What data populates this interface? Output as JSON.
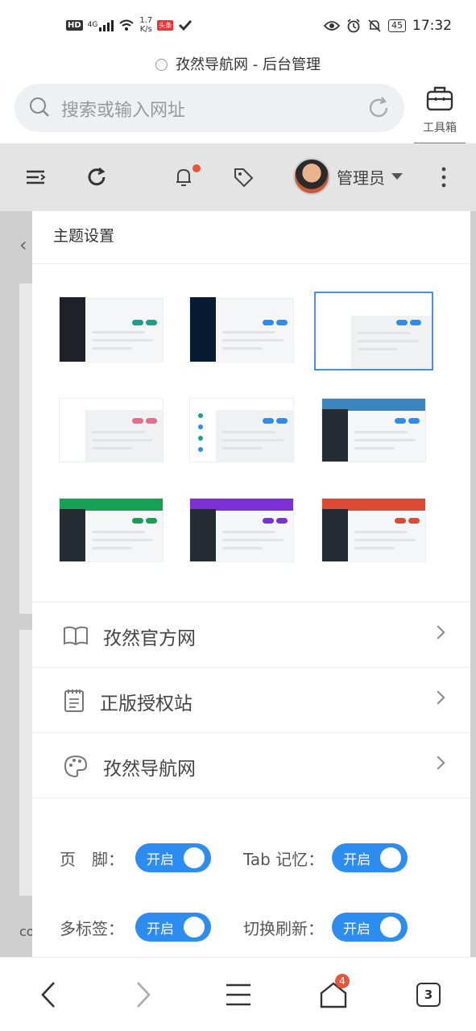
{
  "status_bar": {
    "left_badge": "HD",
    "network": "4G",
    "speed_value": "1.7",
    "speed_unit": "K/s",
    "news_badge": "头条",
    "battery": "45",
    "time": "17:32"
  },
  "browser": {
    "page_title": "孜然导航网 - 后台管理",
    "search_placeholder": "搜索或输入网址",
    "toolbox_label": "工具箱"
  },
  "admin_header": {
    "user_name": "管理员"
  },
  "background_page": {
    "fragment": "co"
  },
  "theme_drawer": {
    "title": "主题设置",
    "themes": [
      {
        "name": "dark-sidebar",
        "side": "#1f2128",
        "accent": "#19a18a",
        "selected": false
      },
      {
        "name": "navy-sidebar",
        "side": "#071b33",
        "accent": "#2d8cf0",
        "selected": false
      },
      {
        "name": "light",
        "side": "#ffffff",
        "accent": "#2d8cf0",
        "selected": true
      },
      {
        "name": "light-pink",
        "side": "#ffffff",
        "accent": "#e86a8c",
        "selected": false
      },
      {
        "name": "light-dots",
        "side": "#ffffff",
        "accent": "#2d8cf0",
        "selected": false
      },
      {
        "name": "blue-top",
        "top": "#3b86c0",
        "side": "#262c33",
        "accent": "#2d8cf0",
        "selected": false
      },
      {
        "name": "green-top",
        "top": "#14a154",
        "side": "#262c33",
        "accent": "#14a154",
        "selected": false
      },
      {
        "name": "purple-top",
        "top": "#7d2fd6",
        "side": "#262c33",
        "accent": "#7d2fd6",
        "selected": false
      },
      {
        "name": "red-top",
        "top": "#dc4a33",
        "side": "#262c33",
        "accent": "#dc4a33",
        "selected": false
      }
    ],
    "links": [
      {
        "label": "孜然官方网",
        "icon": "book-icon"
      },
      {
        "label": "正版授权站",
        "icon": "calendar-icon"
      },
      {
        "label": "孜然导航网",
        "icon": "palette-icon"
      }
    ],
    "settings": [
      {
        "label": "页　脚：",
        "toggle": "开启"
      },
      {
        "label": "Tab 记忆：",
        "toggle": "开启"
      },
      {
        "label": "多标签：",
        "toggle": "开启"
      },
      {
        "label": "切换刷新：",
        "toggle": "开启"
      }
    ]
  },
  "bottom_nav": {
    "home_badge": "4",
    "tabs_count": "3"
  },
  "colors": {
    "accent": "#2d8cf0",
    "notification": "#e2573d"
  }
}
